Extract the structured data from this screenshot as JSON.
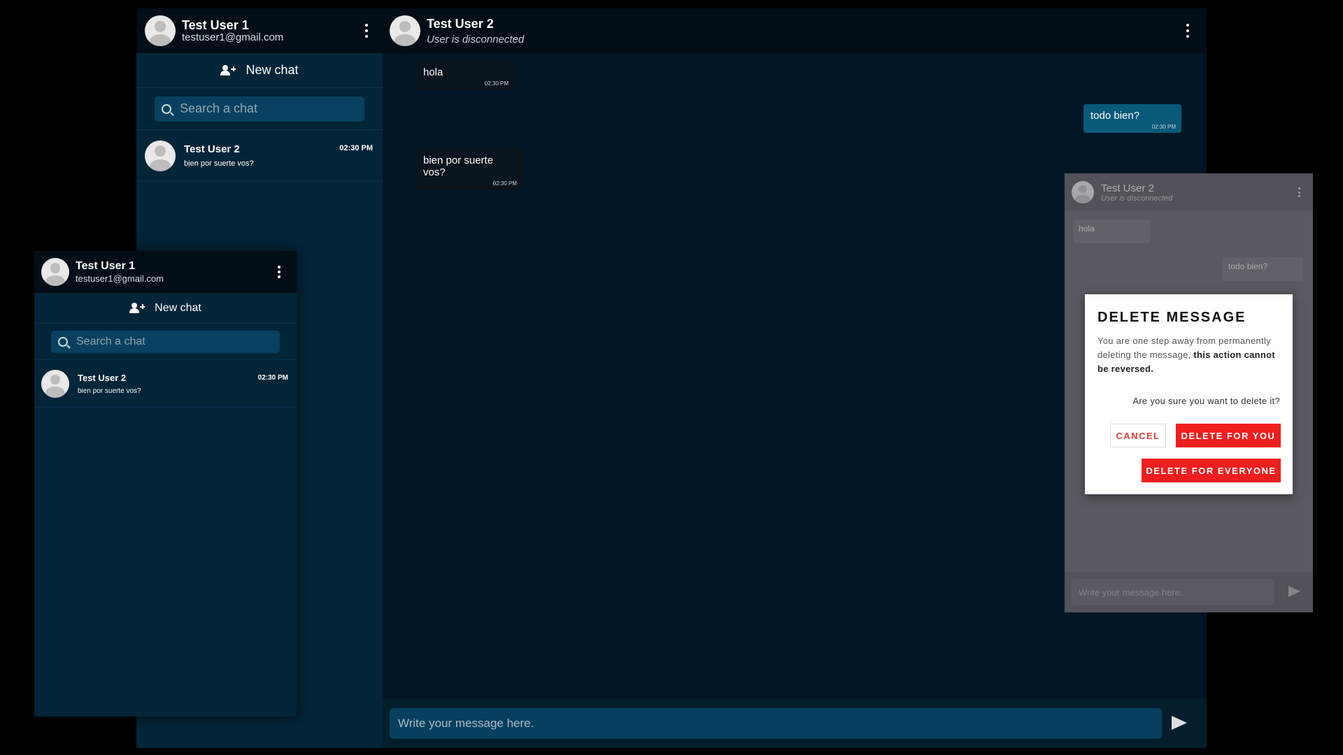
{
  "sidebar": {
    "user_name": "Test User 1",
    "user_email": "testuser1@gmail.com",
    "new_chat_label": "New chat",
    "search_placeholder": "Search a chat",
    "chats": [
      {
        "name": "Test User 2",
        "last_message": "bien por suerte vos?",
        "time": "02:30 PM"
      }
    ]
  },
  "conversation": {
    "contact_name": "Test User 2",
    "status": "User is disconnected",
    "messages": [
      {
        "text": "hola",
        "time": "02:30 PM",
        "direction": "incoming"
      },
      {
        "text": "todo bien?",
        "time": "02:30 PM",
        "direction": "outgoing"
      },
      {
        "text": "bien por suerte vos?",
        "time": "02:30 PM",
        "direction": "incoming"
      }
    ],
    "composer_placeholder": "Write your message here."
  },
  "dialog": {
    "title": "DELETE MESSAGE",
    "body_plain": "You are one step away from permanently deleting the message, ",
    "body_bold": "this action cannot be reversed.",
    "question": "Are you sure you want to delete it?",
    "cancel_label": "CANCEL",
    "delete_for_you_label": "DELETE FOR YOU",
    "delete_for_everyone_label": "DELETE FOR EVERYONE"
  },
  "colors": {
    "accent_blue": "#08597a",
    "danger_red": "#f01e1e",
    "header_dark": "#020d16"
  }
}
